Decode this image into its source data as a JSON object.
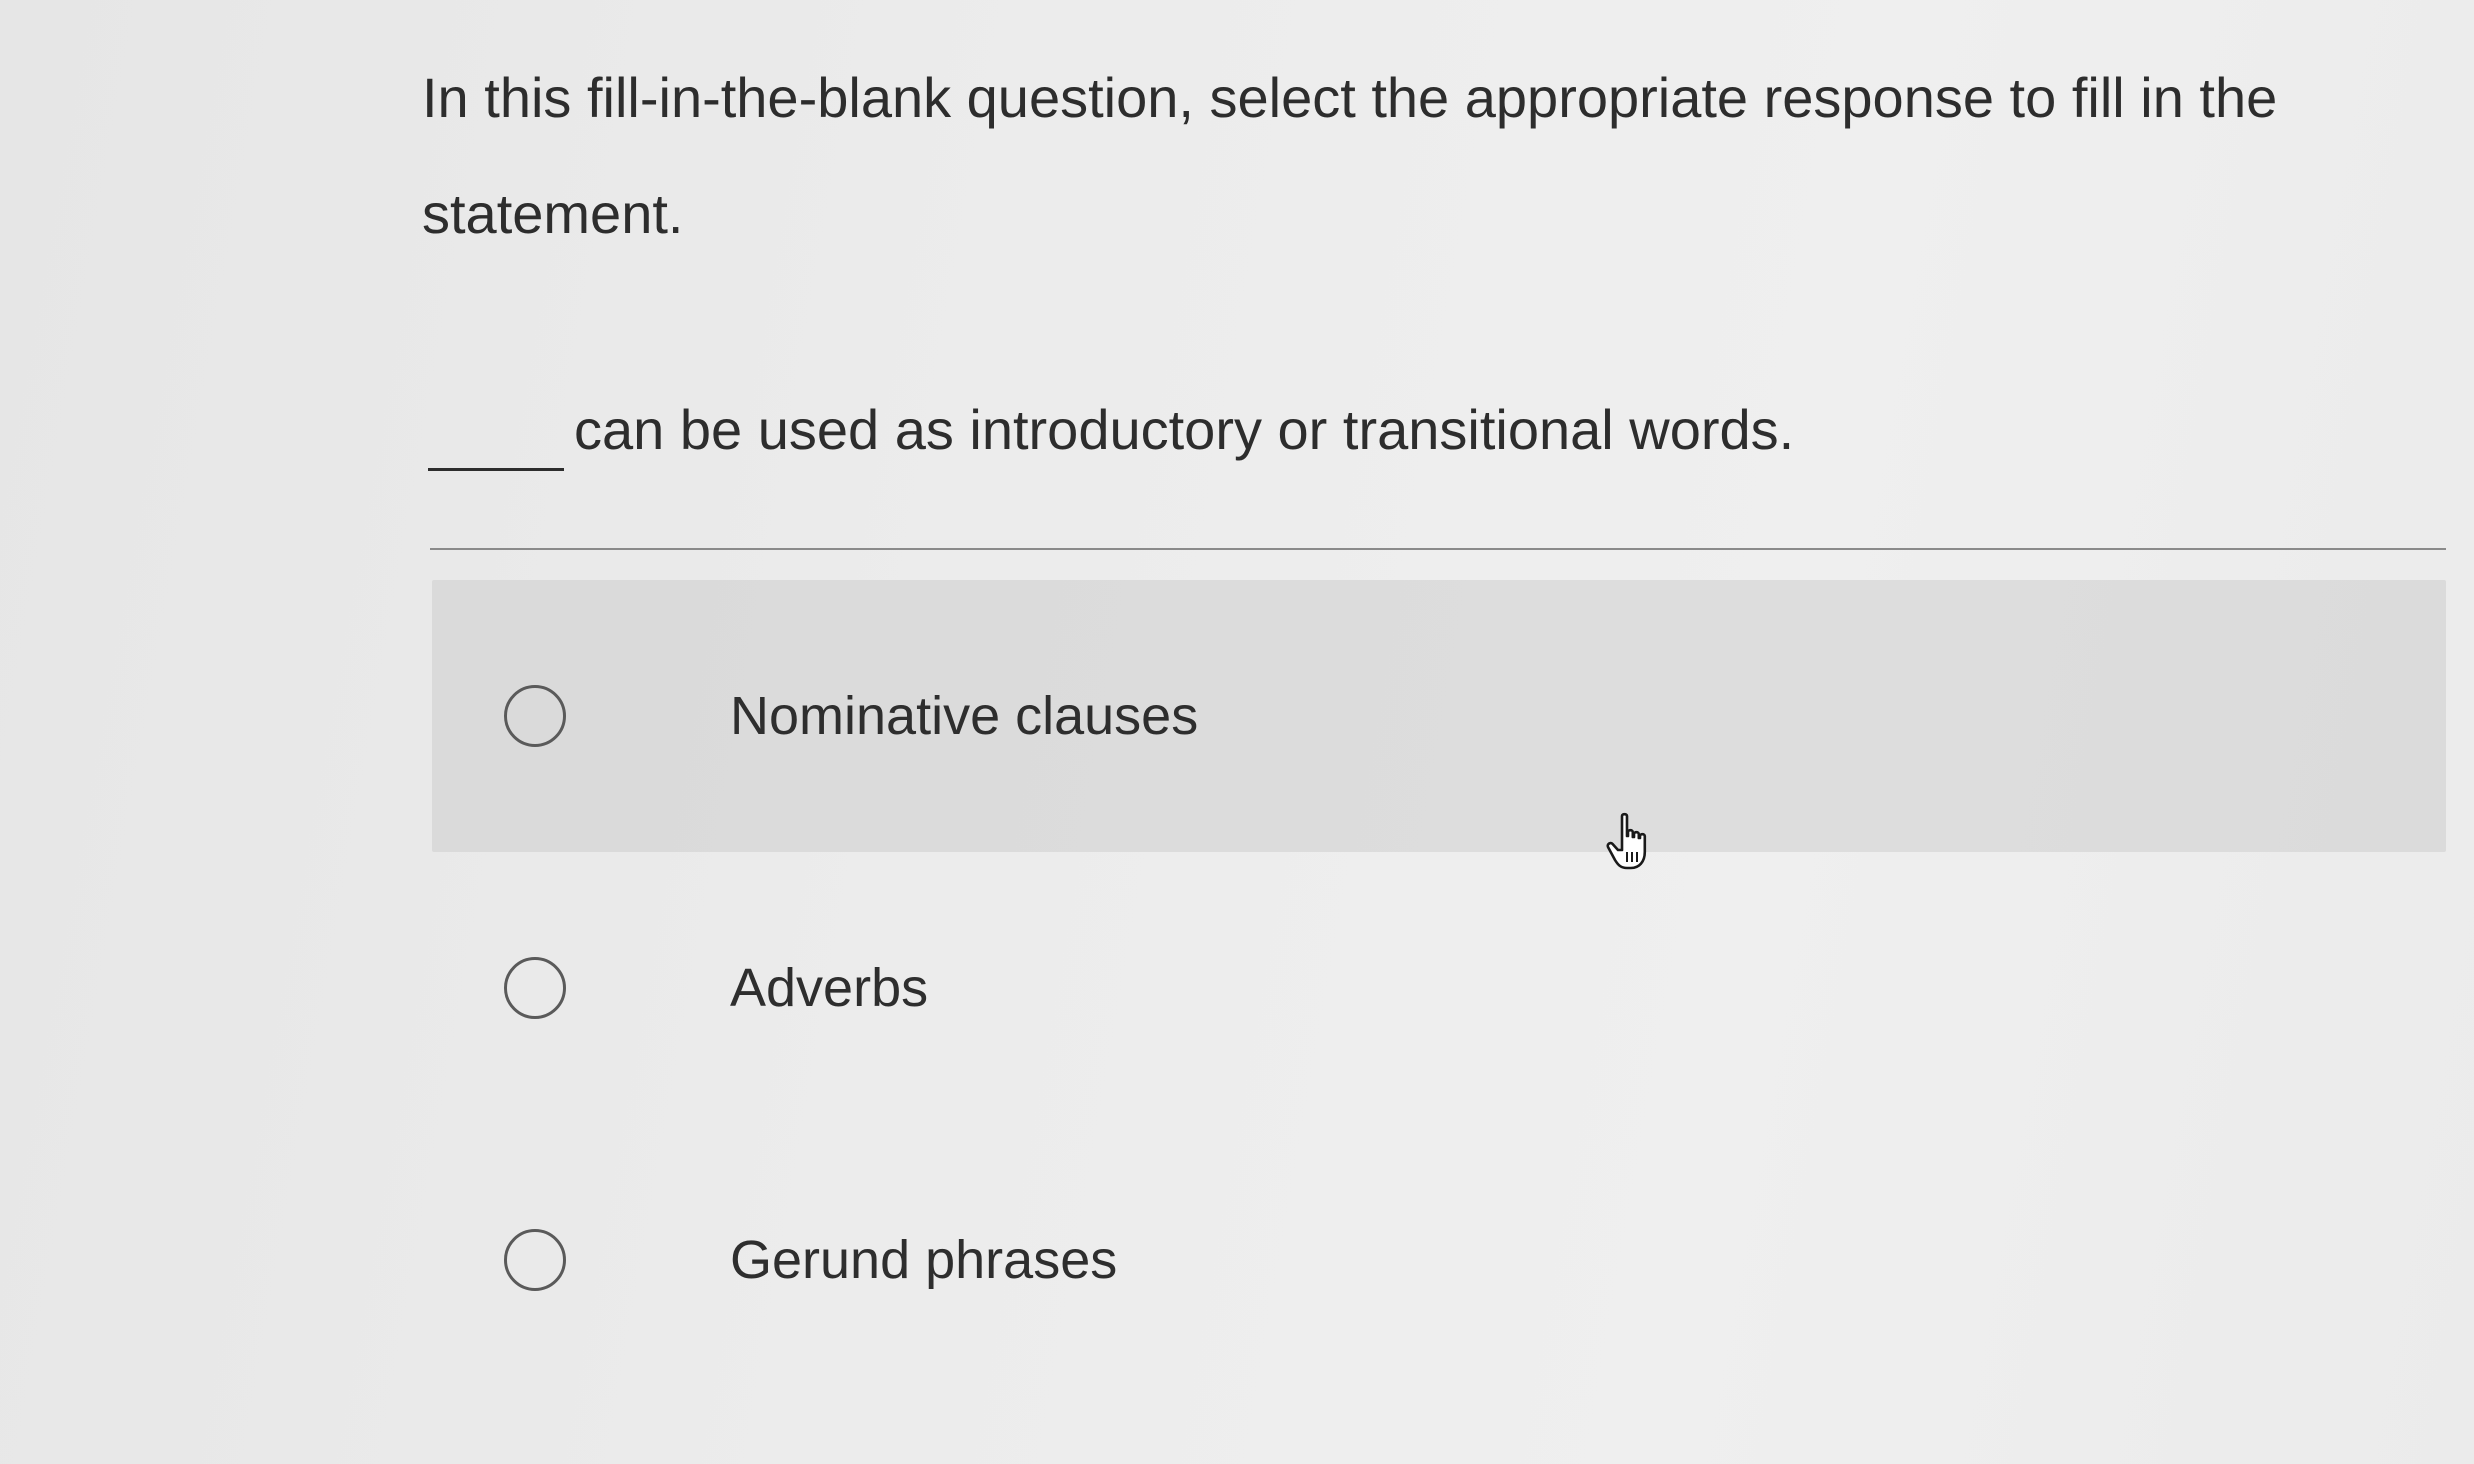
{
  "question": {
    "instructions": "In this fill-in-the-blank question, select the appropriate response to fill in the statement.",
    "statement_text": "can be used as introductory or transitional words."
  },
  "options": [
    {
      "label": "Nominative clauses",
      "selected": false
    },
    {
      "label": "Adverbs",
      "selected": false
    },
    {
      "label": "Gerund phrases",
      "selected": false
    }
  ],
  "cursor": {
    "icon": "hand-pointer-icon"
  }
}
